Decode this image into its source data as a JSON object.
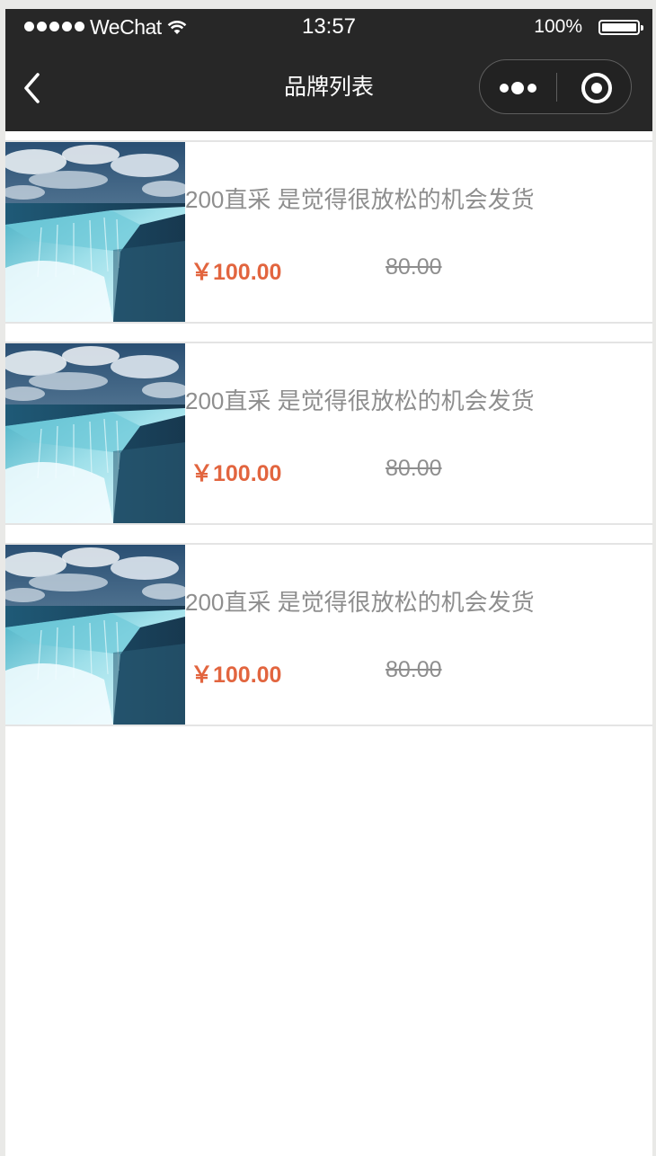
{
  "status_bar": {
    "carrier": "WeChat",
    "time": "13:57",
    "battery": "100%",
    "battery_level": 1.0,
    "signal_dots": 5
  },
  "nav": {
    "title": "品牌列表",
    "back_icon": "chevron-left-icon",
    "more_icon": "more-dots-icon",
    "close_icon": "target-icon"
  },
  "colors": {
    "nav_bg": "#272727",
    "price": "#e2653f",
    "muted_text": "#8e8e8e",
    "divider": "#e4e4e4"
  },
  "products": [
    {
      "title": "200直采 是觉得很放松的机会发货",
      "price": "￥100.00",
      "old_price": "80.00",
      "image_icon": "waterfall-image"
    },
    {
      "title": "200直采 是觉得很放松的机会发货",
      "price": "￥100.00",
      "old_price": "80.00",
      "image_icon": "waterfall-image"
    },
    {
      "title": "200直采 是觉得很放松的机会发货",
      "price": "￥100.00",
      "old_price": "80.00",
      "image_icon": "waterfall-image"
    }
  ]
}
